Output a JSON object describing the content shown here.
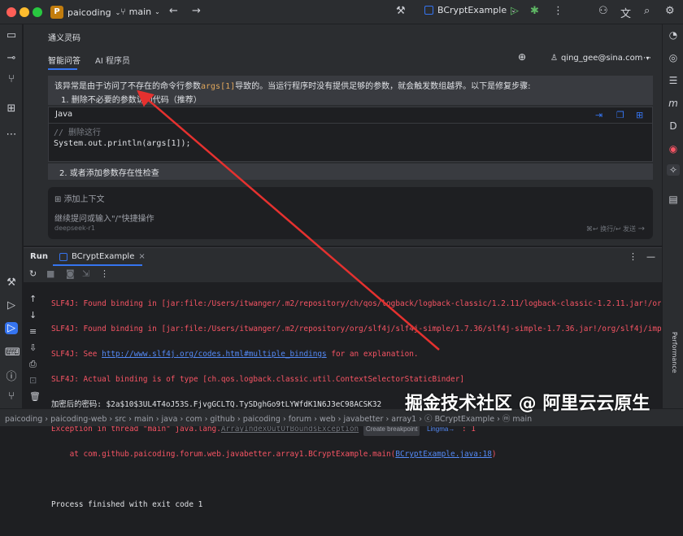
{
  "titlebar": {
    "project_badge": "P",
    "project_name": "paicoding",
    "branch": "main",
    "run_config": "BCryptExample"
  },
  "panel": {
    "title": "通义灵码",
    "tab_qa": "智能问答",
    "tab_dev": "AI 程序员",
    "user_email": "qing_gee@sina.com",
    "message_before": "该异常是由于访问了不存在的命令行参数",
    "message_code": "args[1]",
    "message_after": "导致的。当运行程序时没有提供足够的参数，就会触发数组越界。以下是修复步骤:",
    "step1": "1. 删除不必要的参数访问代码（推荐）",
    "code_lang": "Java",
    "code_comment": "// 删除这行",
    "code_line": "System.out.println(args[1]);",
    "step2": "2. 或者添加参数存在性检查",
    "add_context": "添加上下文",
    "input_placeholder": "继续提问或输入\"/\"快捷操作",
    "model": "deepseek-r1",
    "send_hint": "⌘↩ 换行/↩ 发送"
  },
  "run": {
    "label": "Run",
    "tab": "BCryptExample",
    "lines": [
      "SLF4J: Found binding in [jar:file:/Users/itwanger/.m2/repository/ch/qos/logback/logback-classic/1.2.11/logback-classic-1.2.11.jar!/or",
      "SLF4J: Found binding in [jar:file:/Users/itwanger/.m2/repository/org/slf4j/slf4j-simple/1.7.36/slf4j-simple-1.7.36.jar!/org/slf4j/imp",
      "SLF4J: See ",
      "SLF4J: Actual binding is of type [ch.qos.logback.classic.util.ContextSelectorStaticBinder]"
    ],
    "see_link": "http://www.slf4j.org/codes.html#multiple_bindings",
    "see_after": " for an explanation.",
    "password_line": "加密后的密码: $2a$10$3UL4T4oJ53S.FjvgGCLTQ.TySDghGo9tLYWfdK1N6J3eC98ACSK32",
    "exception_before": "Exception in thread \"main\" java.lang.",
    "exception_class": "ArrayIndexOutOfBoundsException",
    "create_breakpoint": "Create breakpoint",
    "lingma": "Lingma→",
    "exception_after": " : 1",
    "at_before": "    at com.github.paicoding.forum.web.javabetter.array1.BCryptExample.main(",
    "at_link": "BCryptExample.java:18",
    "at_after": ")",
    "finished": "Process finished with exit code 1",
    "performance": "Performance"
  },
  "statusbar": {
    "path": "paicoding  ›  paicoding-web  ›  src  ›  main  ›  java  ›  com  ›  github  ›  paicoding  ›  forum  ›  web  ›  javabetter  ›  array1  ›  ⓒ BCryptExample  ›  ⓜ main"
  },
  "watermark": "掘金技术社区 @ 阿里云云原生",
  "colors": {
    "accent": "#3574f0",
    "error": "#f75464",
    "arrow": "#e5312f"
  }
}
